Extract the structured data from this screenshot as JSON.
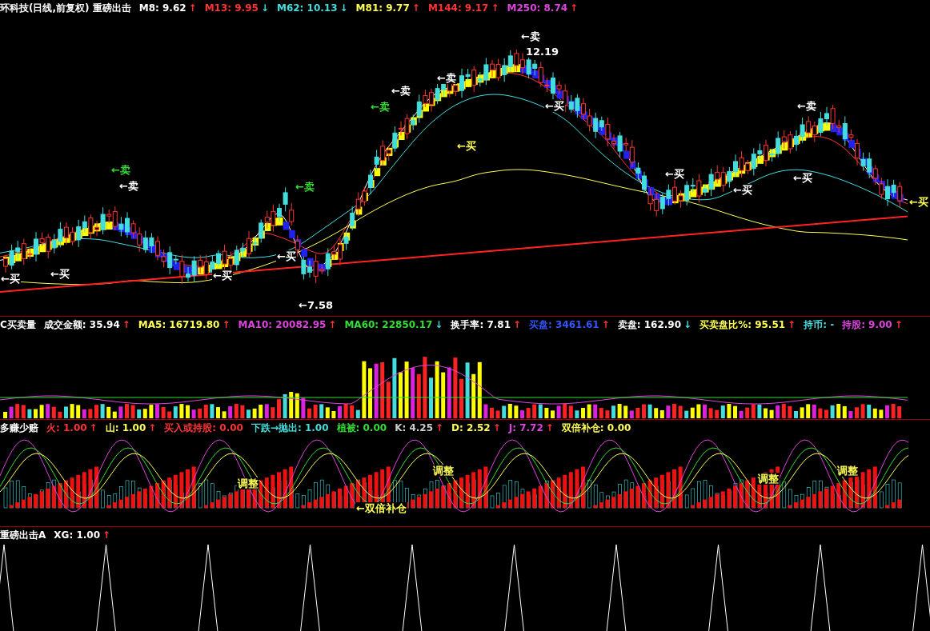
{
  "panels": [
    {
      "kind": "price",
      "header": [
        {
          "text": "环科技(日线,前复权) 重磅出击",
          "color": "#ffffff"
        },
        {
          "text": "M8: 9.62",
          "color": "#ffffff",
          "arrow": "↑",
          "rising": true
        },
        {
          "text": "M13: 9.95",
          "color": "#ff3333",
          "arrow": "↓",
          "rising": false
        },
        {
          "text": "M62: 10.13",
          "color": "#44dddd",
          "arrow": "↓",
          "rising": false
        },
        {
          "text": "M81: 9.77",
          "color": "#ffff55",
          "arrow": "↑",
          "rising": true
        },
        {
          "text": "M144: 9.17",
          "color": "#ff3333",
          "arrow": "↑",
          "rising": true
        },
        {
          "text": "M250: 8.74",
          "color": "#dd44dd",
          "arrow": "↑",
          "rising": true
        }
      ],
      "annotations": [
        {
          "text": "←卖",
          "color": "#33dd33"
        },
        {
          "text": "←卖",
          "color": "#ffffff"
        },
        {
          "text": "←卖",
          "color": "#33dd33"
        },
        {
          "text": "←买",
          "color": "#ffffff"
        },
        {
          "text": "←买",
          "color": "#ffffff"
        },
        {
          "text": "←买",
          "color": "#ffffff"
        },
        {
          "text": "←买",
          "color": "#ffffff"
        },
        {
          "text": "←卖",
          "color": "#33dd33"
        },
        {
          "text": "←卖",
          "color": "#ffffff"
        },
        {
          "text": "←卖",
          "color": "#ffffff"
        },
        {
          "text": "←卖",
          "color": "#ffffff"
        },
        {
          "text": "←买",
          "color": "#ffff55"
        },
        {
          "text": "←买",
          "color": "#ffffff"
        },
        {
          "text": "←买",
          "color": "#ffffff"
        },
        {
          "text": "←买",
          "color": "#ffffff"
        },
        {
          "text": "←买",
          "color": "#ffffff"
        },
        {
          "text": "←卖",
          "color": "#ffffff"
        },
        {
          "text": "←买",
          "color": "#ffff55"
        },
        {
          "text": "12.19",
          "color": "#ffffff"
        },
        {
          "text": "←7.58",
          "color": "#ffffff"
        }
      ]
    },
    {
      "kind": "volume",
      "header": [
        {
          "text": "C买卖量",
          "color": "#ffffff"
        },
        {
          "text": "成交金额: 35.94",
          "color": "#ffffff",
          "arrow": "↑",
          "rising": true
        },
        {
          "text": "MA5: 16719.80",
          "color": "#ffff55",
          "arrow": "↑",
          "rising": true
        },
        {
          "text": "MA10: 20082.95",
          "color": "#dd44dd",
          "arrow": "↑",
          "rising": true
        },
        {
          "text": "MA60: 22850.17",
          "color": "#33dd33",
          "arrow": "↓",
          "rising": false
        },
        {
          "text": "换手率: 7.81",
          "color": "#ffffff",
          "arrow": "↑",
          "rising": true
        },
        {
          "text": "买盘: 3461.61",
          "color": "#3355ff",
          "arrow": "↑",
          "rising": true
        },
        {
          "text": "卖盘: 162.90",
          "color": "#ffffff",
          "arrow": "↓",
          "rising": false
        },
        {
          "text": "买卖盘比%: 95.51",
          "color": "#ffff55",
          "arrow": "↑",
          "rising": true
        },
        {
          "text": "持币: -",
          "color": "#44dddd"
        },
        {
          "text": "持股: 9.00",
          "color": "#dd44dd",
          "arrow": "↑",
          "rising": true
        }
      ]
    },
    {
      "kind": "oscillator",
      "header": [
        {
          "text": "多赚少赔",
          "color": "#ffffff"
        },
        {
          "text": "火: 1.00",
          "color": "#ff3333",
          "arrow": "↑",
          "rising": true
        },
        {
          "text": "山: 1.00",
          "color": "#ffff55",
          "arrow": "↑",
          "rising": true
        },
        {
          "text": "买入或持股: 0.00",
          "color": "#ff3333"
        },
        {
          "text": "下跌→抛出: 1.00",
          "color": "#44dddd"
        },
        {
          "text": "植被: 0.00",
          "color": "#33dd33"
        },
        {
          "text": "K: 4.25",
          "color": "#cccccc",
          "arrow": "↑",
          "rising": true
        },
        {
          "text": "D: 2.52",
          "color": "#ffff55",
          "arrow": "↑",
          "rising": true
        },
        {
          "text": "J: 7.72",
          "color": "#dd44dd",
          "arrow": "↑",
          "rising": true
        },
        {
          "text": "双倍补仓: 0.00",
          "color": "#ffff55"
        }
      ],
      "annotations": [
        {
          "text": "调整",
          "color": "#ffff55"
        },
        {
          "text": "调整",
          "color": "#ffff55"
        },
        {
          "text": "调整",
          "color": "#ffff55"
        },
        {
          "text": "调整",
          "color": "#ffff55"
        },
        {
          "text": "←双倍补仓",
          "color": "#ffff55"
        }
      ]
    },
    {
      "kind": "signal",
      "header": [
        {
          "text": "重磅出击A",
          "color": "#ffffff"
        },
        {
          "text": "XG: 1.00",
          "color": "#ffffff",
          "arrow": "↑",
          "rising": true
        }
      ]
    }
  ]
}
